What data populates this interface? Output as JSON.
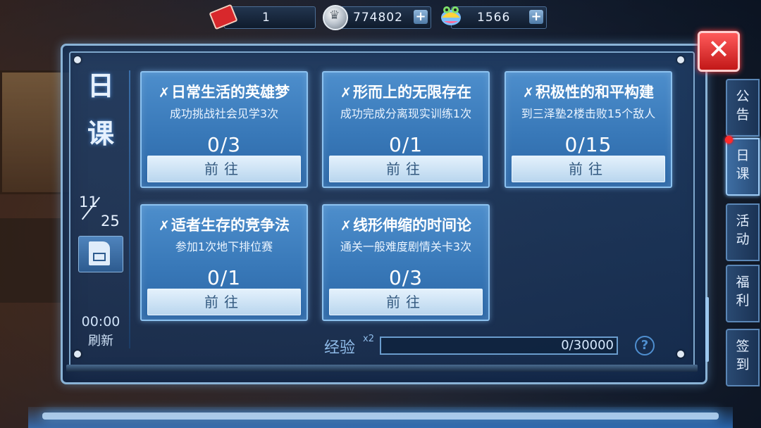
{
  "resources": {
    "ticket": "1",
    "coins": "774802",
    "gems": "1566",
    "plus": "+"
  },
  "left": {
    "title_1": "日",
    "title_2": "课",
    "count_current": "11",
    "count_max": "25",
    "timer": "00:00",
    "refresh_label": "刷新"
  },
  "tasks": [
    {
      "check": "✗",
      "title": "日常生活的英雄梦",
      "desc": "成功挑战社会见学3次",
      "progress": "0/3",
      "button": "前往"
    },
    {
      "check": "✗",
      "title": "形而上的无限存在",
      "desc": "成功完成分离现实训练1次",
      "progress": "0/1",
      "button": "前往"
    },
    {
      "check": "✗",
      "title": "积极性的和平构建",
      "desc": "到三泽塾2楼击败15个敌人",
      "progress": "0/15",
      "button": "前往"
    },
    {
      "check": "✗",
      "title": "适者生存的竞争法",
      "desc": "参加1次地下排位赛",
      "progress": "0/1",
      "button": "前往"
    },
    {
      "check": "✗",
      "title": "线形伸缩的时间论",
      "desc": "通关一般难度剧情关卡3次",
      "progress": "0/3",
      "button": "前往"
    }
  ],
  "exp": {
    "label": "经验",
    "multiplier": "x2",
    "value": "0/30000",
    "progress_fraction": 0
  },
  "close": "✕",
  "side_tabs": [
    {
      "label": "公告",
      "active": false
    },
    {
      "label": "日课",
      "active": true
    },
    {
      "label": "活动",
      "active": false
    },
    {
      "label": "福利",
      "active": false
    },
    {
      "label": "签到",
      "active": false
    }
  ],
  "colors": {
    "accent": "#3878b8",
    "button": "#d2e7f8",
    "close": "#e02828",
    "notify": "#ff2a2a"
  }
}
